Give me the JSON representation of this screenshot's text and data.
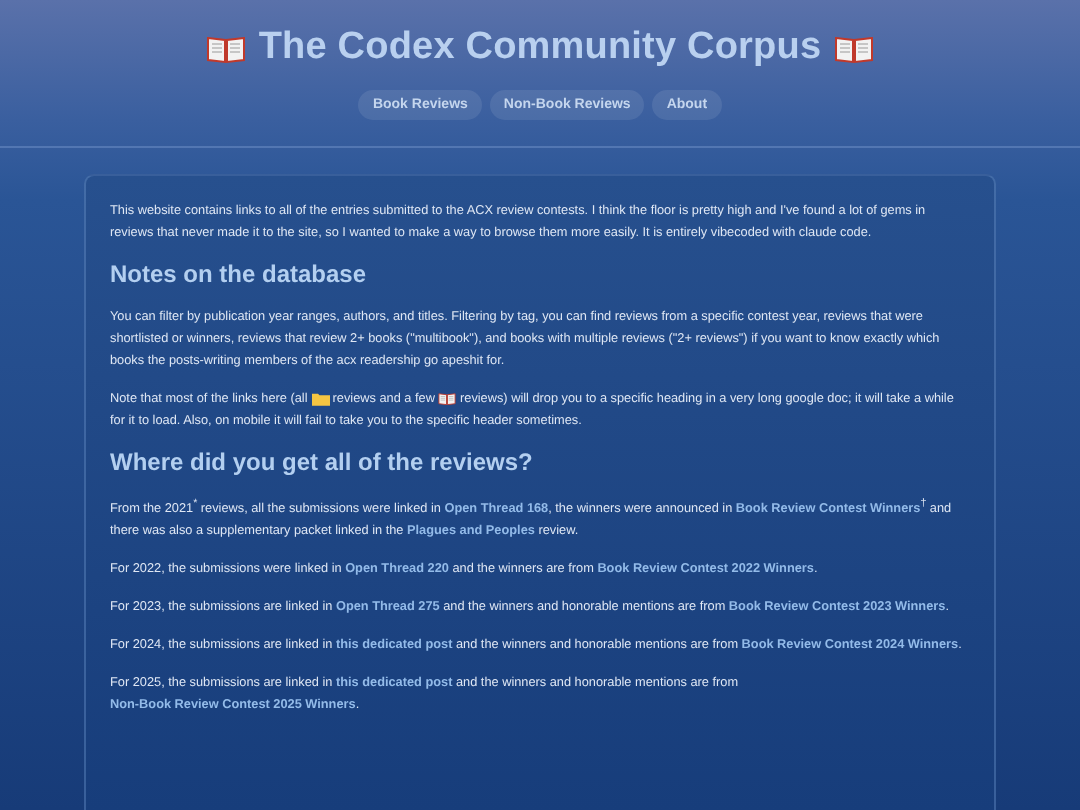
{
  "header": {
    "title": "The Codex Community Corpus"
  },
  "nav": [
    {
      "label": "Book Reviews"
    },
    {
      "label": "Non-Book Reviews"
    },
    {
      "label": "About"
    }
  ],
  "content": [
    {
      "kind": "paragraph",
      "segments": [
        {
          "kind": "text",
          "text": "This website contains links to all of the entries submitted to the ACX review contests. I think the floor is pretty high and I've found a lot of gems in reviews that never made it to the site, so I wanted to make a way to browse them more easily. It is entirely vibecoded with claude code."
        }
      ]
    },
    {
      "kind": "heading",
      "text": "Notes on the database"
    },
    {
      "kind": "paragraph",
      "segments": [
        {
          "kind": "text",
          "text": "You can filter by publication year ranges, authors, and titles. Filtering by tag, you can find reviews from a specific contest year, reviews that were shortlisted or winners, reviews that review 2+ books (\"multibook\"), and books with multiple reviews (\"2+ reviews\") if you want to know exactly which books the posts-writing members of the acx readership go apeshit for."
        }
      ]
    },
    {
      "kind": "paragraph",
      "segments": [
        {
          "kind": "text",
          "text": "Note that most of the links here (all "
        },
        {
          "kind": "icon"
        },
        {
          "kind": "text",
          "text": " reviews and a few "
        },
        {
          "kind": "icon"
        },
        {
          "kind": "text",
          "text": " reviews) will drop you to a specific heading in a very long google doc; it will take a while for it to load. Also, on mobile it will fail to take you to the specific header sometimes."
        }
      ]
    },
    {
      "kind": "heading",
      "text": "Where did you get all of the reviews?"
    },
    {
      "kind": "paragraph",
      "segments": [
        {
          "kind": "text",
          "text": "From the 2021$^{*}$ reviews, all the submissions were linked in "
        },
        {
          "kind": "link",
          "text": "Open Thread 168"
        },
        {
          "kind": "text",
          "text": ", the winners were announced in "
        },
        {
          "kind": "link",
          "text": "Book Review Contest Winners"
        },
        {
          "kind": "text",
          "text": "$^{†}$ and there was also a supplementary packet linked in the "
        },
        {
          "kind": "link",
          "text": "Plagues and Peoples"
        },
        {
          "kind": "text",
          "text": " review."
        }
      ]
    },
    {
      "kind": "paragraph",
      "segments": [
        {
          "kind": "text",
          "text": "For 2022, the submissions were linked in "
        },
        {
          "kind": "link",
          "text": "Open Thread 220"
        },
        {
          "kind": "text",
          "text": " and the winners are from "
        },
        {
          "kind": "link",
          "text": "Book Review Contest 2022 Winners"
        },
        {
          "kind": "text",
          "text": "."
        }
      ]
    },
    {
      "kind": "paragraph",
      "segments": [
        {
          "kind": "text",
          "text": "For 2023, the submissions are linked in "
        },
        {
          "kind": "link",
          "text": "Open Thread 275"
        },
        {
          "kind": "text",
          "text": " and the winners and honorable mentions are from "
        },
        {
          "kind": "link",
          "text": "Book Review Contest 2023 Winners"
        },
        {
          "kind": "text",
          "text": "."
        }
      ]
    },
    {
      "kind": "paragraph",
      "segments": [
        {
          "kind": "text",
          "text": "For 2024, the submissions are linked in "
        },
        {
          "kind": "link",
          "text": "this dedicated post"
        },
        {
          "kind": "text",
          "text": " and the winners and honorable mentions are from "
        },
        {
          "kind": "link",
          "text": "Book Review Contest 2024 Winners"
        },
        {
          "kind": "text",
          "text": "."
        }
      ]
    },
    {
      "kind": "paragraph",
      "segments": [
        {
          "kind": "text",
          "text": "For 2025, the submissions are linked in "
        },
        {
          "kind": "link",
          "text": "this dedicated post"
        },
        {
          "kind": "text",
          "text": " and the winners and honorable mentions are from "
        },
        {
          "kind": "link",
          "text": "Non-Book Review Contest 2025 Winners"
        },
        {
          "kind": "text",
          "text": "."
        }
      ]
    }
  ]
}
